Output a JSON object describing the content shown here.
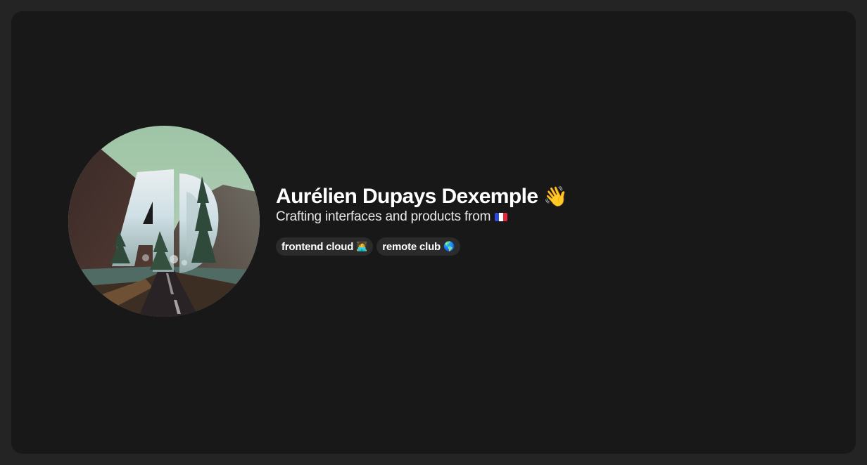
{
  "profile": {
    "name": "Aurélien Dupays Dexemple",
    "name_emoji_icon": "waving-hand-icon",
    "name_emoji": "👋",
    "tagline": "Crafting interfaces and products from",
    "tagline_flag_icon": "france-flag-icon",
    "avatar_icon": "avatar-monogram-landscape"
  },
  "chips": [
    {
      "label": "frontend cloud",
      "icon": "technologist-icon",
      "glyph": "🧑‍💻"
    },
    {
      "label": "remote club",
      "icon": "globe-icon",
      "glyph": "🌎"
    }
  ],
  "colors": {
    "page_frame": "#242424",
    "panel_bg": "#181818",
    "chip_bg": "#2b2b2b",
    "text_primary": "#ffffff",
    "text_secondary": "#e8e8e8"
  }
}
